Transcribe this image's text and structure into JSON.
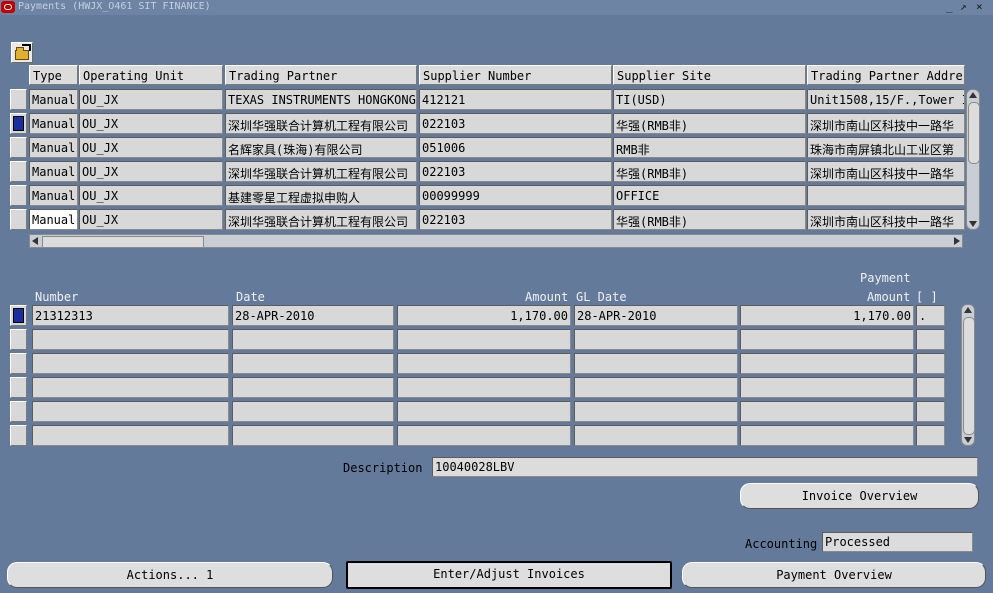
{
  "window": {
    "title": "Payments (HWJX_O461 SIT FINANCE)",
    "controls": [
      "_",
      "↗",
      "×"
    ]
  },
  "toolbar": {
    "icon": "open-folder-icon"
  },
  "payments_table": {
    "headers": [
      "Type",
      "Operating Unit",
      "Trading Partner",
      "Supplier Number",
      "Supplier Site",
      "Trading Partner Address"
    ],
    "rows": [
      {
        "type": "Manual",
        "ou": "OU_JX",
        "partner": "TEXAS INSTRUMENTS HONGKONG",
        "supplier_number": "412121",
        "site": "TI(USD)",
        "address": "Unit1508,15/F.,Tower I"
      },
      {
        "type": "Manual",
        "ou": "OU_JX",
        "partner": "深圳华强联合计算机工程有限公司",
        "supplier_number": "022103",
        "site": "华强(RMB非)",
        "address": "深圳市南山区科技中一路华"
      },
      {
        "type": "Manual",
        "ou": "OU_JX",
        "partner": "名辉家具(珠海)有限公司",
        "supplier_number": "051006",
        "site": "RMB非",
        "address": "珠海市南屏镇北山工业区第"
      },
      {
        "type": "Manual",
        "ou": "OU_JX",
        "partner": "深圳华强联合计算机工程有限公司",
        "supplier_number": "022103",
        "site": "华强(RMB非)",
        "address": "深圳市南山区科技中一路华"
      },
      {
        "type": "Manual",
        "ou": "OU_JX",
        "partner": "基建零星工程虚拟申购人",
        "supplier_number": "00099999",
        "site": "OFFICE",
        "address": ""
      },
      {
        "type": "Manual",
        "ou": "OU_JX",
        "partner": "深圳华强联合计算机工程有限公司",
        "supplier_number": "022103",
        "site": "华强(RMB非)",
        "address": "深圳市南山区科技中一路华"
      }
    ]
  },
  "detail_table": {
    "headers": {
      "number": "Number",
      "date": "Date",
      "amount": "Amount",
      "gl_date": "GL Date",
      "payment_label": "Payment",
      "payment_amount": "Amount",
      "bracket": "[ ]"
    },
    "rows": [
      {
        "number": "21312313",
        "date": "28-APR-2010",
        "amount": "1,170.00",
        "gl_date": "28-APR-2010",
        "payment_amount": "1,170.00",
        "flag": "."
      },
      {
        "number": "",
        "date": "",
        "amount": "",
        "gl_date": "",
        "payment_amount": "",
        "flag": ""
      },
      {
        "number": "",
        "date": "",
        "amount": "",
        "gl_date": "",
        "payment_amount": "",
        "flag": ""
      },
      {
        "number": "",
        "date": "",
        "amount": "",
        "gl_date": "",
        "payment_amount": "",
        "flag": ""
      },
      {
        "number": "",
        "date": "",
        "amount": "",
        "gl_date": "",
        "payment_amount": "",
        "flag": ""
      },
      {
        "number": "",
        "date": "",
        "amount": "",
        "gl_date": "",
        "payment_amount": "",
        "flag": ""
      }
    ]
  },
  "description": {
    "label": "Description",
    "value": "10040028LBV"
  },
  "accounting": {
    "label": "Accounting",
    "value": "Processed"
  },
  "buttons": {
    "invoice_overview": "Invoice Overview",
    "actions": "Actions... 1",
    "enter_adjust": "Enter/Adjust Invoices",
    "payment_overview": "Payment Overview"
  }
}
